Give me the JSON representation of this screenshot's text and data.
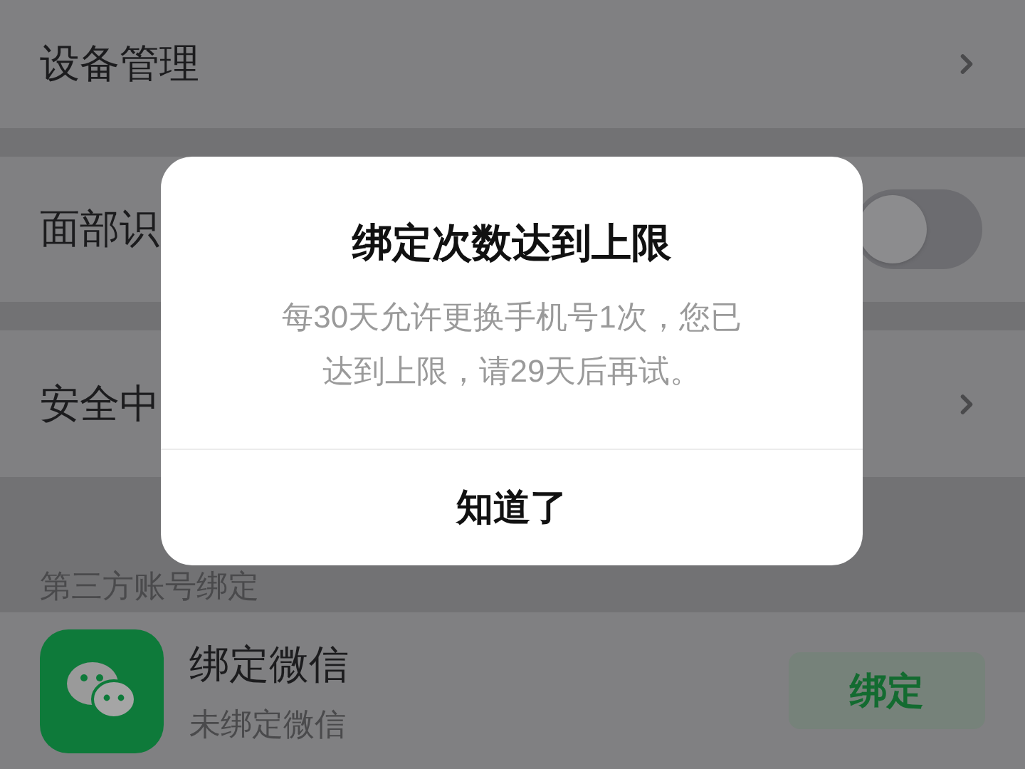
{
  "settings": [
    {
      "kind": "link",
      "label": "设备管理"
    },
    {
      "kind": "toggle",
      "label": "面部识",
      "on": false
    },
    {
      "kind": "link",
      "label": "安全中"
    }
  ],
  "section_header": "第三方账号绑定",
  "bindings": [
    {
      "title": "绑定微信",
      "subtitle": "未绑定微信",
      "button": "绑定"
    }
  ],
  "dialog": {
    "title": "绑定次数达到上限",
    "message": "每30天允许更换手机号1次，您已达到上限，请29天后再试。",
    "button": "知道了"
  }
}
